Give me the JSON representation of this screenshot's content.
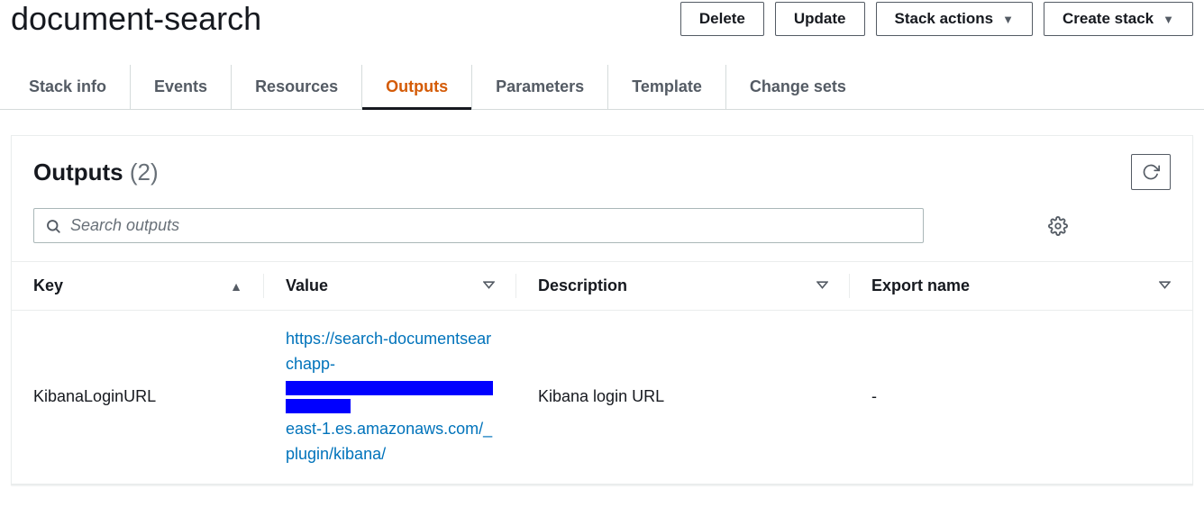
{
  "stack_name": "document-search",
  "buttons": {
    "delete": "Delete",
    "update": "Update",
    "stack_actions": "Stack actions",
    "create_stack": "Create stack"
  },
  "tabs": [
    {
      "id": "stack-info",
      "label": "Stack info",
      "active": false
    },
    {
      "id": "events",
      "label": "Events",
      "active": false
    },
    {
      "id": "resources",
      "label": "Resources",
      "active": false
    },
    {
      "id": "outputs",
      "label": "Outputs",
      "active": true
    },
    {
      "id": "parameters",
      "label": "Parameters",
      "active": false
    },
    {
      "id": "template",
      "label": "Template",
      "active": false
    },
    {
      "id": "change-sets",
      "label": "Change sets",
      "active": false
    }
  ],
  "panel": {
    "title": "Outputs",
    "count": "(2)"
  },
  "search": {
    "placeholder": "Search outputs"
  },
  "columns": {
    "key": "Key",
    "value": "Value",
    "description": "Description",
    "export_name": "Export name"
  },
  "rows": [
    {
      "key": "KibanaLoginURL",
      "value_prefix": "https://search-documentsearchapp-",
      "value_suffix": "east-1.es.amazonaws.com/_plugin/kibana/",
      "description": "Kibana login URL",
      "export_name": "-"
    }
  ]
}
